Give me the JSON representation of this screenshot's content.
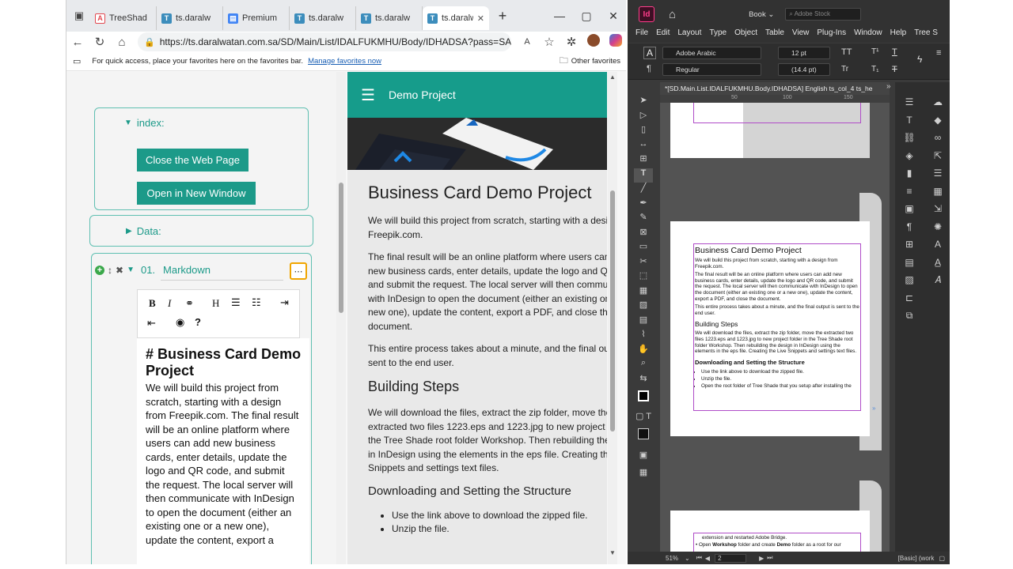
{
  "browser": {
    "tabs": [
      {
        "title": "TreeShad",
        "icon": "adobe-icon",
        "color": "#e34850"
      },
      {
        "title": "ts.daralw",
        "icon": "treeshade-icon",
        "color": "#3c8dbc"
      },
      {
        "title": "Premium",
        "icon": "forms-icon",
        "color": "#4285f4"
      },
      {
        "title": "ts.daralw",
        "icon": "treeshade-icon",
        "color": "#3c8dbc"
      },
      {
        "title": "ts.daralw",
        "icon": "treeshade-icon",
        "color": "#3c8dbc"
      },
      {
        "title": "ts.daralw",
        "icon": "treeshade-icon",
        "color": "#3c8dbc"
      }
    ],
    "url": "https://ts.daralwatan.com.sa/SD/Main/List/IDALFUKMHU/Body/IDHADSA?pass=SAME",
    "favbar_text": "For quick access, place your favorites here on the favorites bar.",
    "favbar_link": "Manage favorites now",
    "other_favorites": "Other favorites"
  },
  "tree": {
    "index_label": "index:",
    "close_button": "Close the Web Page",
    "open_button": "Open in New Window",
    "data_label": "Data:",
    "markdown_number": "01.",
    "markdown_label": "Markdown",
    "toolbar": {
      "bold": "B",
      "italic": "I",
      "heading": "H"
    },
    "editor_heading": "# Business Card Demo Project",
    "editor_body": "We will build this project from scratch, starting with a design from Freepik.com. The final result will be an online platform where users can add new business cards, enter details, update the logo and QR code, and submit the request. The local server will then communicate with InDesign to open the document (either an existing one or a new one), update the content, export a"
  },
  "preview": {
    "header_title": "Demo Project",
    "h1": "Business Card Demo Project",
    "p1": [
      "We will build this project from scratch, starting with a desig",
      "Freepik.com."
    ],
    "p2": [
      "The final result will be an online platform where users can a",
      "new business cards, enter details, update the logo and QR c",
      "and submit the request. The local server will then commun",
      "with InDesign to open the document (either an existing one",
      "new one), update the content, export a PDF, and close the",
      "document."
    ],
    "p3": [
      "This entire process takes about a minute, and the final outp",
      "sent to the end user."
    ],
    "h2": "Building Steps",
    "p4": [
      "We will download the files, extract the zip folder, move the",
      "extracted two files 1223.eps and 1223.jpg to new project f",
      "the Tree Shade root folder Workshop. Then rebuilding the d",
      "in InDesign using the elements in the eps file. Creating the",
      "Snippets and settings text files."
    ],
    "h3": "Downloading and Setting the Structure",
    "list": [
      "Use the link above to download the zipped file.",
      "Unzip the file."
    ]
  },
  "indesign": {
    "app_badge": "Id",
    "workspace": "Book",
    "search_placeholder": "Adobe Stock",
    "menu": [
      "File",
      "Edit",
      "Layout",
      "Type",
      "Object",
      "Table",
      "View",
      "Plug-Ins",
      "Window",
      "Help",
      "Tree S"
    ],
    "font_family": "Adobe Arabic",
    "font_style": "Regular",
    "font_size": "12 pt",
    "leading": "(14.4 pt)",
    "doc_tab": "*[SD.Main.List.IDALFUKMHU.Body.IDHADSA] English ts_col_4 ts_he",
    "ruler_marks": [
      "50",
      "100",
      "150"
    ],
    "page_title": "Business Card Demo Project",
    "page_p1": "We will build this project from scratch, starting with a design from Freepik.com.",
    "page_p2": "The final result will be an online platform where users can add new business cards, enter details, update the logo and QR code, and submit the request. The local server will then communicate with InDesign to open the document (either an existing one or a new one), update the content, export a PDF, and close the document.",
    "page_p3": "This entire process takes about a minute, and the final output is sent to the end user.",
    "page_h2": "Building Steps",
    "page_p4": "We will download the files, extract the zip folder, move the extracted two files 1223.eps and 1223.jpg to new project folder in the Tree Shade root folder Workshop. Then rebuilding the design in InDesign using the elements in the eps file. Creating the Live Snippets and settings text files.",
    "page_h3": "Downloading and Setting the Structure",
    "page_list": [
      "Use the link above to download the zipped file.",
      "Unzip the file.",
      "Open the root folder of Tree Shade that you setup after installing the"
    ],
    "page2_line1": "extension and restarted Adobe Bridge.",
    "page2_line2_pre": "Open ",
    "page2_line2_b1": "Workshop",
    "page2_line2_mid": " folder and create ",
    "page2_line2_b2": "Demo",
    "page2_line2_post": " folder as a root for our",
    "zoom": "51%",
    "page_number": "2",
    "status": "[Basic] (work"
  }
}
